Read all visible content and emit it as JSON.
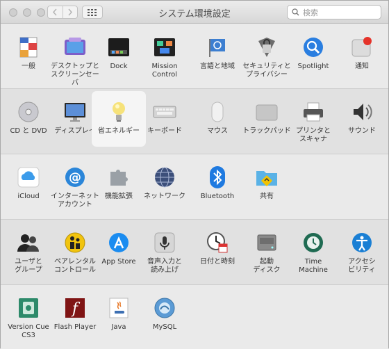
{
  "window": {
    "title": "システム環境設定",
    "search_placeholder": "検索"
  },
  "sections": [
    {
      "items": [
        {
          "label": "一般",
          "icon": "general-icon"
        },
        {
          "label": "デスクトップと\nスクリーンセーバ",
          "icon": "desktop-icon"
        },
        {
          "label": "Dock",
          "icon": "dock-icon"
        },
        {
          "label": "Mission\nControl",
          "icon": "mission-control-icon"
        },
        {
          "label": "言語と地域",
          "icon": "language-region-icon"
        },
        {
          "label": "セキュリティと\nプライバシー",
          "icon": "security-icon"
        },
        {
          "label": "Spotlight",
          "icon": "spotlight-icon"
        },
        {
          "label": "通知",
          "icon": "notifications-icon"
        }
      ]
    },
    {
      "items": [
        {
          "label": "CD と DVD",
          "icon": "cd-dvd-icon"
        },
        {
          "label": "ディスプレイ",
          "icon": "display-icon"
        },
        {
          "label": "省エネルギー",
          "icon": "energy-saver-icon",
          "selected": true
        },
        {
          "label": "キーボード",
          "icon": "keyboard-icon"
        },
        {
          "label": "マウス",
          "icon": "mouse-icon"
        },
        {
          "label": "トラックパッド",
          "icon": "trackpad-icon"
        },
        {
          "label": "プリンタと\nスキャナ",
          "icon": "printer-icon"
        },
        {
          "label": "サウンド",
          "icon": "sound-icon"
        }
      ]
    },
    {
      "items": [
        {
          "label": "iCloud",
          "icon": "icloud-icon"
        },
        {
          "label": "インターネット\nアカウント",
          "icon": "internet-accounts-icon"
        },
        {
          "label": "機能拡張",
          "icon": "extensions-icon"
        },
        {
          "label": "ネットワーク",
          "icon": "network-icon"
        },
        {
          "label": "Bluetooth",
          "icon": "bluetooth-icon"
        },
        {
          "label": "共有",
          "icon": "sharing-icon"
        }
      ]
    },
    {
      "items": [
        {
          "label": "ユーザと\nグループ",
          "icon": "users-groups-icon"
        },
        {
          "label": "ペアレンタル\nコントロール",
          "icon": "parental-controls-icon"
        },
        {
          "label": "App Store",
          "icon": "app-store-icon"
        },
        {
          "label": "音声入力と\n読み上げ",
          "icon": "dictation-speech-icon"
        },
        {
          "label": "日付と時刻",
          "icon": "date-time-icon"
        },
        {
          "label": "起動\nディスク",
          "icon": "startup-disk-icon"
        },
        {
          "label": "Time\nMachine",
          "icon": "time-machine-icon"
        },
        {
          "label": "アクセシ\nビリティ",
          "icon": "accessibility-icon"
        }
      ]
    },
    {
      "items": [
        {
          "label": "Version Cue\nCS3",
          "icon": "version-cue-icon"
        },
        {
          "label": "Flash Player",
          "icon": "flash-player-icon"
        },
        {
          "label": "Java",
          "icon": "java-icon"
        },
        {
          "label": "MySQL",
          "icon": "mysql-icon"
        }
      ]
    }
  ]
}
